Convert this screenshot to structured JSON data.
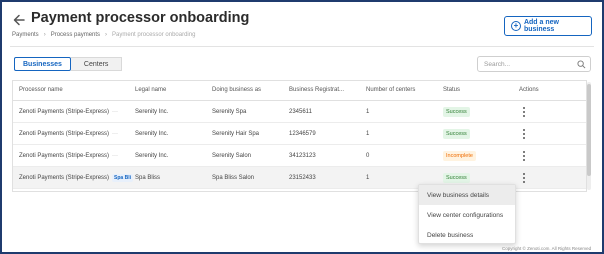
{
  "header": {
    "title": "Payment processor onboarding",
    "add_button_label": "Add a new business",
    "breadcrumb": [
      "Payments",
      "Process payments",
      "Payment processor onboarding"
    ]
  },
  "tabs": [
    "Businesses",
    "Centers"
  ],
  "search": {
    "placeholder": "Search..."
  },
  "table": {
    "columns": [
      "Processor name",
      "Legal name",
      "Doing business as",
      "Business Registrat...",
      "Number of centers",
      "Status",
      "Actions"
    ],
    "rows": [
      {
        "processor": "Zenoti Payments (Stripe-Express)",
        "chip": "",
        "legal": "Serenity Inc.",
        "dba": "Serenity Spa",
        "reg": "2345611",
        "centers": "1",
        "status": "Success"
      },
      {
        "processor": "Zenoti Payments (Stripe-Express)",
        "chip": "",
        "legal": "Serenity Inc.",
        "dba": "Serenity Hair Spa",
        "reg": "12346579",
        "centers": "1",
        "status": "Success"
      },
      {
        "processor": "Zenoti Payments (Stripe-Express)",
        "chip": "",
        "legal": "Serenity Inc.",
        "dba": "Serenity Salon",
        "reg": "34123123",
        "centers": "0",
        "status": "Incomplete"
      },
      {
        "processor": "Zenoti Payments (Stripe-Express)",
        "chip": "Spa Bli",
        "legal": "Spa Bliss",
        "dba": "Spa Bliss Salon",
        "reg": "23152433",
        "centers": "1",
        "status": "Success"
      }
    ]
  },
  "actions_menu": [
    "View business details",
    "View center configurations",
    "Delete business"
  ],
  "footer": "Copyright © Zenoti.com. All Rights Reserved",
  "colors": {
    "accent": "#1565c0",
    "success": "#2e7d32",
    "incomplete": "#ef6c00",
    "frame": "#1f3b6e"
  }
}
